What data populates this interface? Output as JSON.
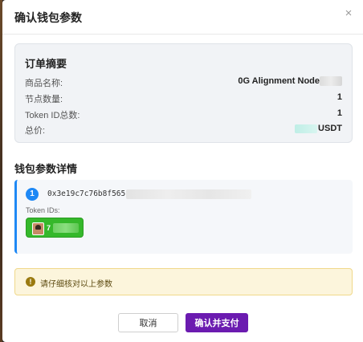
{
  "modal": {
    "title": "确认钱包参数",
    "close_symbol": "×"
  },
  "summary": {
    "title": "订单摘要",
    "rows": [
      {
        "label": "商品名称:",
        "value": "0G Alignment Node"
      },
      {
        "label": "节点数量:",
        "value": "1"
      },
      {
        "label": "Token ID总数:",
        "value": "1"
      },
      {
        "label": "总价:",
        "value": "USDT"
      }
    ]
  },
  "details": {
    "title": "钱包参数详情",
    "wallets": [
      {
        "index": "1",
        "address": "0x3e19c7c76b8f565",
        "token_ids_label": "Token IDs:",
        "token_prefix": "7"
      }
    ]
  },
  "warning": {
    "icon": "!",
    "text": "请仔细核对以上参数"
  },
  "buttons": {
    "cancel": "取消",
    "confirm": "确认并支付"
  },
  "colors": {
    "accent": "#6b1bb0",
    "usdt": "#1fb89a",
    "wallet_border": "#1e88f5",
    "chip": "#35b82b",
    "warning_bg": "#fcf5dc"
  }
}
